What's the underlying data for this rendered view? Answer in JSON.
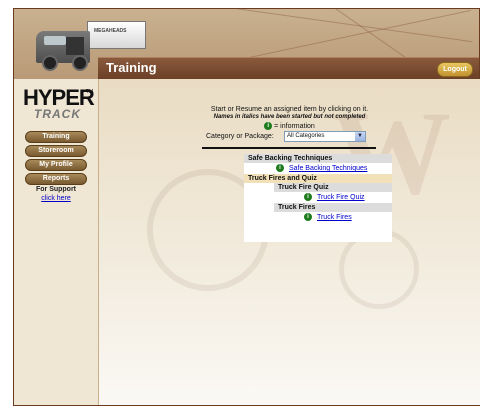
{
  "header": {
    "trailer_text": "MEGAHEADS",
    "logout_label": "Logout"
  },
  "page": {
    "title": "Training"
  },
  "sidebar": {
    "logo_top": "HYPER",
    "logo_bottom": "TRACK",
    "logo_tm": "TM",
    "nav": [
      "Training",
      "Storeroom",
      "My Profile",
      "Reports"
    ],
    "support_label": "For Support",
    "support_link": "click here"
  },
  "instructions": {
    "line1": "Start or Resume an assigned item by clicking on it.",
    "line2": "Names in italics have been started but not completed",
    "info_legend": "= information",
    "category_label": "Category or Package:",
    "category_value": "All Categories"
  },
  "results": [
    {
      "heading": "Safe Backing Techniques",
      "items": [
        "Safe Backing Techniques"
      ]
    },
    {
      "heading": "Truck Fires and Quiz",
      "groups": [
        {
          "label": "Truck Fire Quiz",
          "items": [
            "Truck Fire Quiz"
          ]
        },
        {
          "label": "Truck Fires",
          "items": [
            "Truck Fires"
          ]
        }
      ]
    }
  ]
}
